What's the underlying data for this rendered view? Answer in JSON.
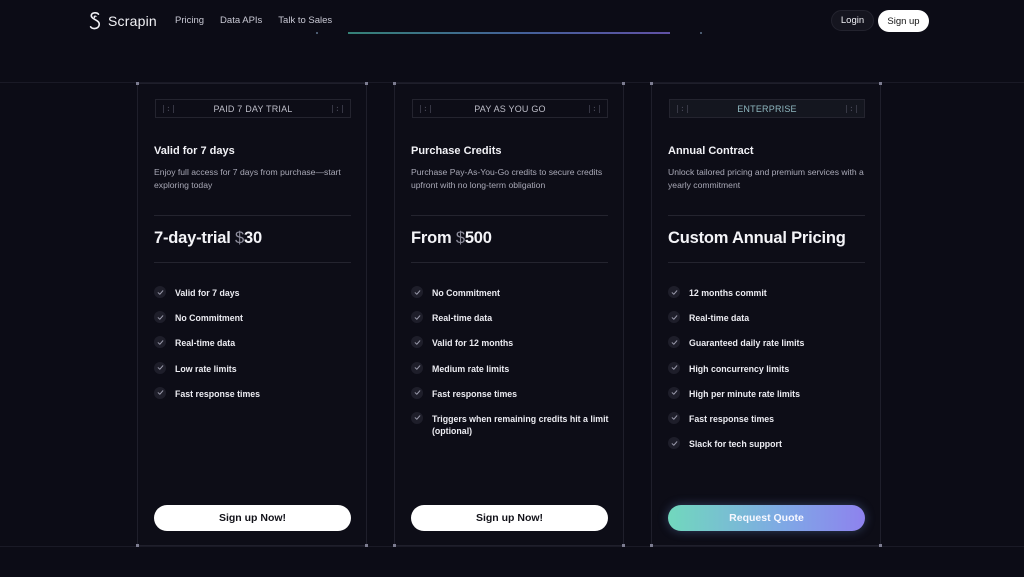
{
  "brand": {
    "name": "Scrapin"
  },
  "nav": {
    "links": [
      "Pricing",
      "Data APIs",
      "Talk to Sales"
    ],
    "login": "Login",
    "signup": "Sign up"
  },
  "plans": [
    {
      "tag": "PAID 7 DAY TRIAL",
      "title": "Valid for 7 days",
      "desc": "Enjoy full access for 7 days from purchase—start exploring today",
      "price_prefix": "7-day-trial ",
      "price_symbol": "$",
      "price_value": "30",
      "features": [
        "Valid for 7 days",
        "No Commitment",
        "Real-time data",
        "Low rate limits",
        "Fast response times"
      ],
      "cta": "Sign up Now!"
    },
    {
      "tag": "PAY AS YOU GO",
      "title": "Purchase Credits",
      "desc": "Purchase Pay-As-You-Go credits to secure credits upfront with no long-term obligation",
      "price_prefix": "From ",
      "price_symbol": "$",
      "price_value": "500",
      "features": [
        "No Commitment",
        "Real-time data",
        "Valid for 12 months",
        "Medium rate limits",
        "Fast response times",
        "Triggers when remaining credits hit a limit (optional)"
      ],
      "cta": "Sign up Now!"
    },
    {
      "tag": "ENTERPRISE",
      "title": "Annual Contract",
      "desc": "Unlock tailored pricing and premium services with a yearly commitment",
      "price_prefix": "Custom Annual Pricing",
      "price_symbol": "",
      "price_value": "",
      "features": [
        "12 months commit",
        "Real-time data",
        "Guaranteed daily rate limits",
        "High concurrency limits",
        "High per minute rate limits",
        "Fast response times",
        "Slack for tech support"
      ],
      "cta": "Request Quote"
    }
  ],
  "colors": {
    "background": "#0c0c16",
    "card_border": "#1f1f2b",
    "accent_gradient_start": "#71d8bd",
    "accent_gradient_end": "#8e82ee"
  },
  "icons": {
    "check": "check-icon",
    "logo": "scrapin-logo-icon"
  }
}
